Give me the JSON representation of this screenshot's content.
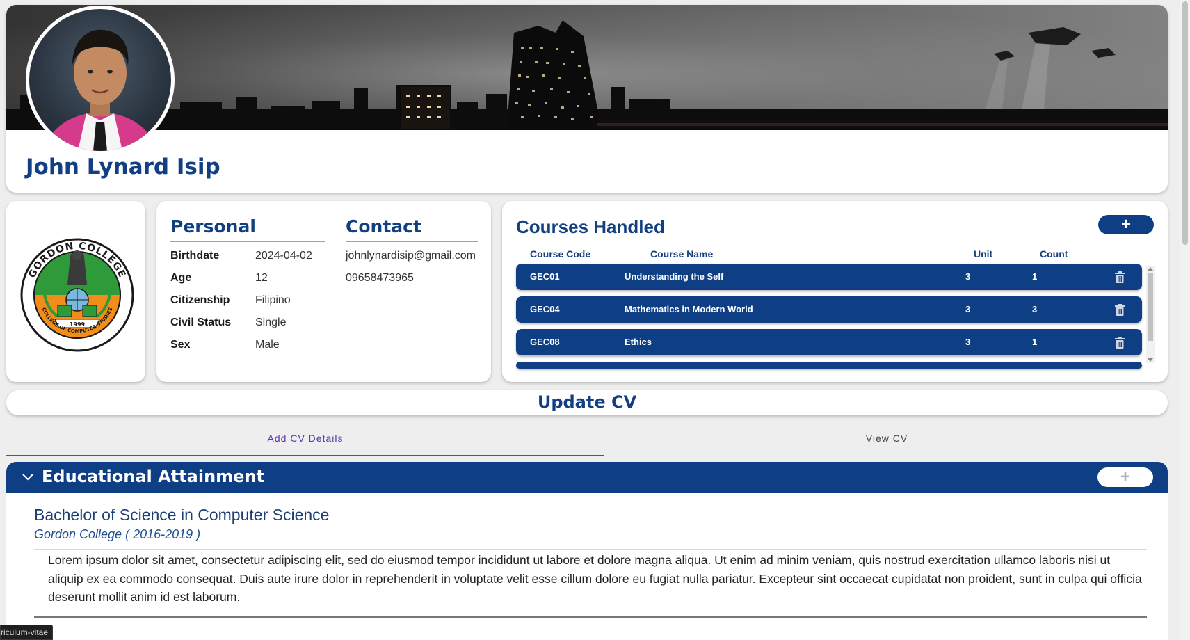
{
  "profile": {
    "name": "John Lynard Isip"
  },
  "logo": {
    "ring_text_top": "GORDON COLLEGE",
    "ring_text_bottom": "COLLEGE OF COMPUTER STUDIES",
    "year": "1999",
    "colors": {
      "green": "#2e9a3a",
      "orange": "#f28c1a",
      "ink": "#1a1a1a"
    }
  },
  "personal": {
    "title": "Personal",
    "fields": [
      {
        "label": "Birthdate",
        "value": "2024-04-02"
      },
      {
        "label": "Age",
        "value": "12"
      },
      {
        "label": "Citizenship",
        "value": "Filipino"
      },
      {
        "label": "Civil Status",
        "value": "Single"
      },
      {
        "label": "Sex",
        "value": "Male"
      }
    ]
  },
  "contact": {
    "title": "Contact",
    "email": "johnlynardisip@gmail.com",
    "phone": "09658473965"
  },
  "courses": {
    "title": "Courses Handled",
    "add_icon": "plus-icon",
    "headers": {
      "code": "Course Code",
      "name": "Course Name",
      "unit": "Unit",
      "count": "Count"
    },
    "rows": [
      {
        "code": "GEC01",
        "name": "Understanding the Self",
        "unit": "3",
        "count": "1"
      },
      {
        "code": "GEC04",
        "name": "Mathematics in Modern World",
        "unit": "3",
        "count": "3"
      },
      {
        "code": "GEC08",
        "name": "Ethics",
        "unit": "3",
        "count": "1"
      }
    ]
  },
  "update_cv": {
    "title": "Update CV"
  },
  "tabs": [
    {
      "label": "Add CV Details",
      "active": true
    },
    {
      "label": "View CV",
      "active": false
    }
  ],
  "education": {
    "section_title": "Educational Attainment",
    "degree": "Bachelor of Science in Computer Science",
    "school": "Gordon College ( 2016-2019 )",
    "description": "Lorem ipsum dolor sit amet, consectetur adipiscing elit, sed do eiusmod tempor incididunt ut labore et dolore magna aliqua. Ut enim ad minim veniam, quis nostrud exercitation ullamco laboris nisi ut aliquip ex ea commodo consequat. Duis aute irure dolor in reprehenderit in voluptate velit esse cillum dolore eu fugiat nulla pariatur. Excepteur sint occaecat cupidatat non proident, sunt in culpa qui officia deserunt mollit anim id est laborum."
  },
  "status_tooltip": "riculum-vitae",
  "theme": {
    "primary": "#0e3e84",
    "accent_tab": "#6a3cc0",
    "background": "#eeeeee"
  }
}
